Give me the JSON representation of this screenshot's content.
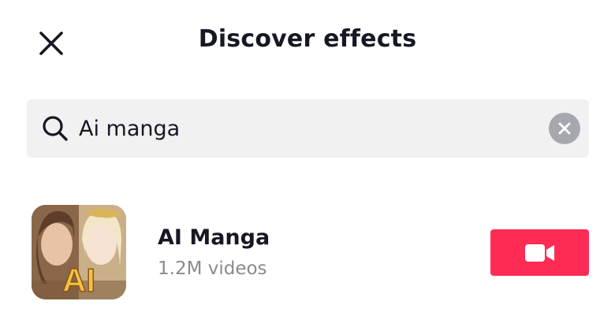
{
  "header": {
    "title": "Discover effects",
    "close_icon": "close-icon"
  },
  "search": {
    "value": "Ai manga",
    "search_icon": "search-icon",
    "clear_icon": "clear-icon"
  },
  "results": [
    {
      "name": "AI Manga",
      "count": "1.2M videos",
      "thumbnail_text": "AI",
      "action_icon": "video-camera-icon"
    }
  ],
  "colors": {
    "accent": "#fe2c55",
    "search_bg": "#f1f1f2",
    "muted_text": "#8a8b91"
  }
}
